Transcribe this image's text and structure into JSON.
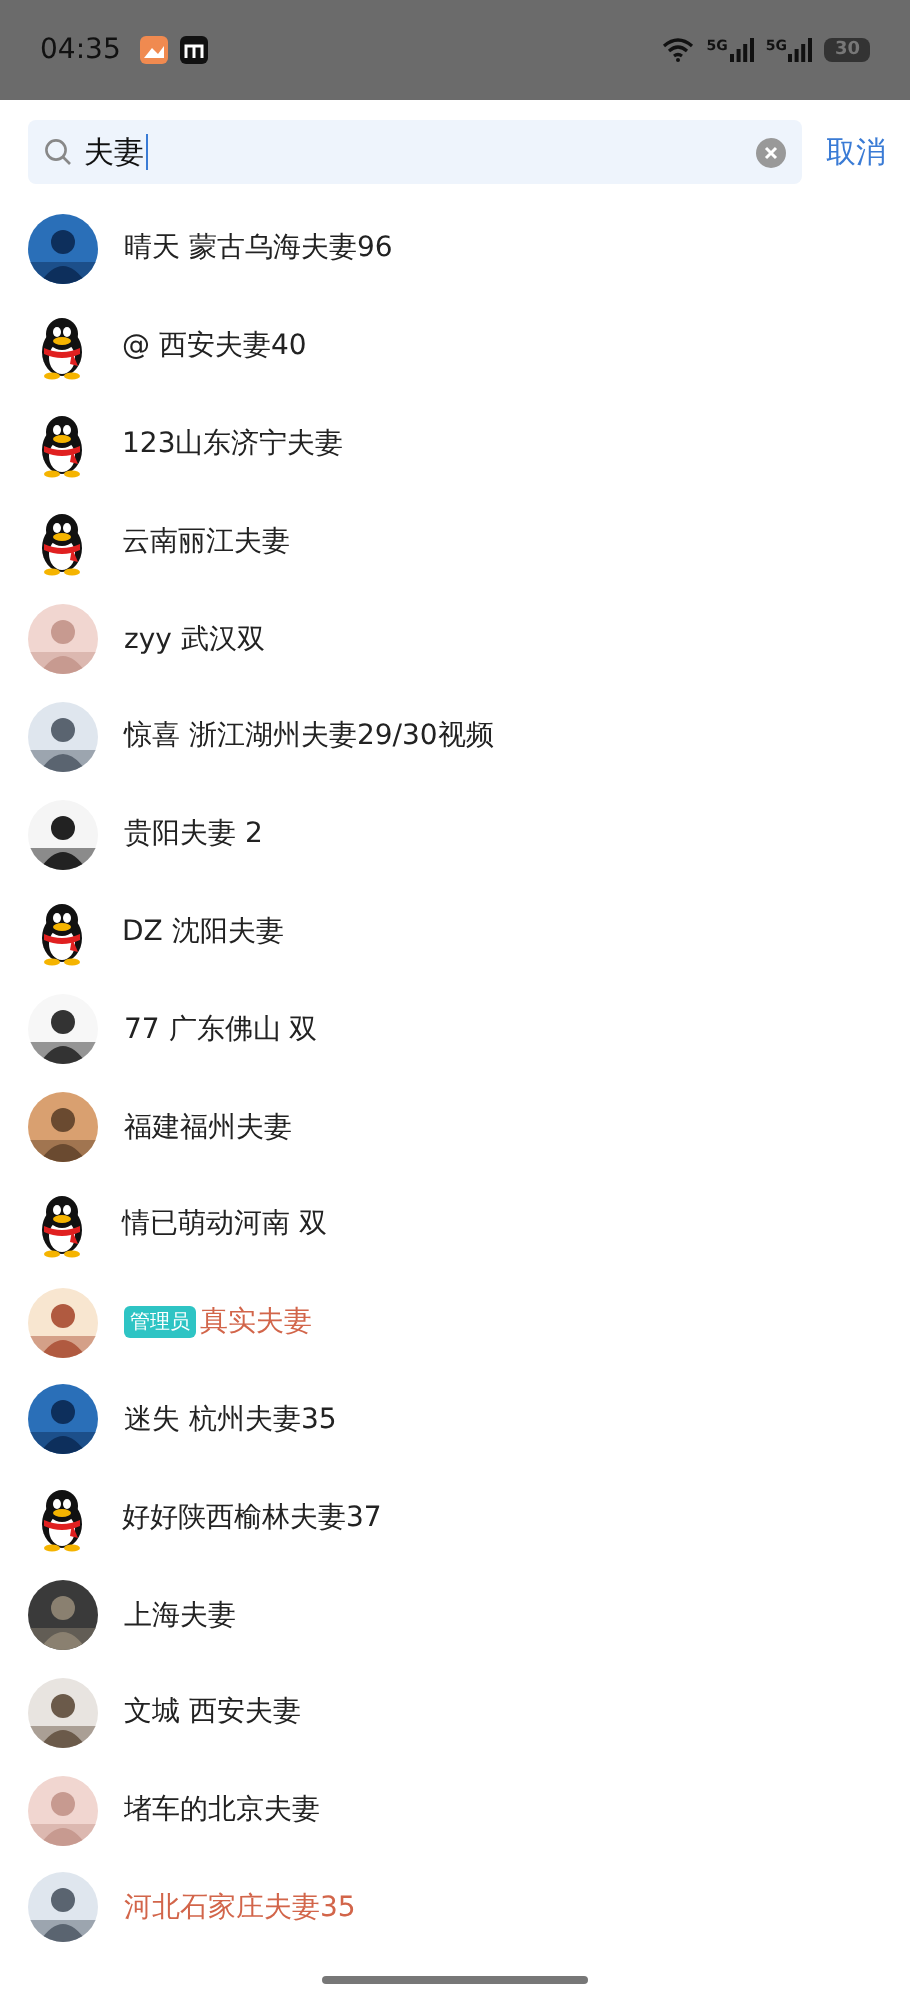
{
  "status_bar": {
    "time": "04:35",
    "network_labels": [
      "5G",
      "5G"
    ],
    "battery": "30"
  },
  "search": {
    "value": "夫妻",
    "cancel": "取消"
  },
  "members": [
    {
      "name": "晴天  蒙古乌海夫妻96",
      "highlighted": false
    },
    {
      "name": "@ 西安夫妻40",
      "kind": "penguin",
      "highlighted": false
    },
    {
      "name": "123山东济宁夫妻",
      "kind": "penguin",
      "highlighted": false
    },
    {
      "name": "云南丽江夫妻",
      "kind": "penguin",
      "highlighted": false
    },
    {
      "name": "zyy  武汉双",
      "highlighted": false
    },
    {
      "name": "惊喜 浙江湖州夫妻29/30视频",
      "highlighted": false
    },
    {
      "name": "贵阳夫妻 2",
      "highlighted": false
    },
    {
      "name": "DZ 沈阳夫妻",
      "kind": "penguin",
      "highlighted": false
    },
    {
      "name": "77 广东佛山 双",
      "highlighted": false
    },
    {
      "name": "福建福州夫妻",
      "highlighted": false
    },
    {
      "name": "情已萌动河南 双",
      "kind": "penguin",
      "highlighted": false
    },
    {
      "name": "真实夫妻",
      "highlighted": true,
      "badge": "管理员"
    },
    {
      "name": "迷失 杭州夫妻35",
      "highlighted": false
    },
    {
      "name": "好好陕西榆林夫妻37",
      "kind": "penguin",
      "highlighted": false
    },
    {
      "name": "上海夫妻",
      "highlighted": false
    },
    {
      "name": "文城 西安夫妻",
      "highlighted": false
    },
    {
      "name": "堵车的北京夫妻",
      "highlighted": false
    },
    {
      "name": "河北石家庄夫妻35",
      "highlighted": true
    }
  ]
}
